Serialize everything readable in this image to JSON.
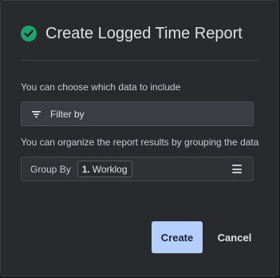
{
  "dialog": {
    "title": "Create Logged Time Report",
    "title_icon": "check-circle-icon"
  },
  "include_section": {
    "label": "You can choose which data to include",
    "filter_button_label": "Filter by",
    "filter_icon": "filter-icon"
  },
  "group_section": {
    "label": "You can organize the report results by grouping the data",
    "group_by_label": "Group By",
    "groups": [
      {
        "number": "1.",
        "name": "Worklog"
      }
    ],
    "menu_icon": "hamburger-menu-icon"
  },
  "actions": {
    "create_label": "Create",
    "cancel_label": "Cancel"
  },
  "colors": {
    "success": "#22a06b",
    "primary_button": "#b5d0ff",
    "background": "#282a2d"
  }
}
